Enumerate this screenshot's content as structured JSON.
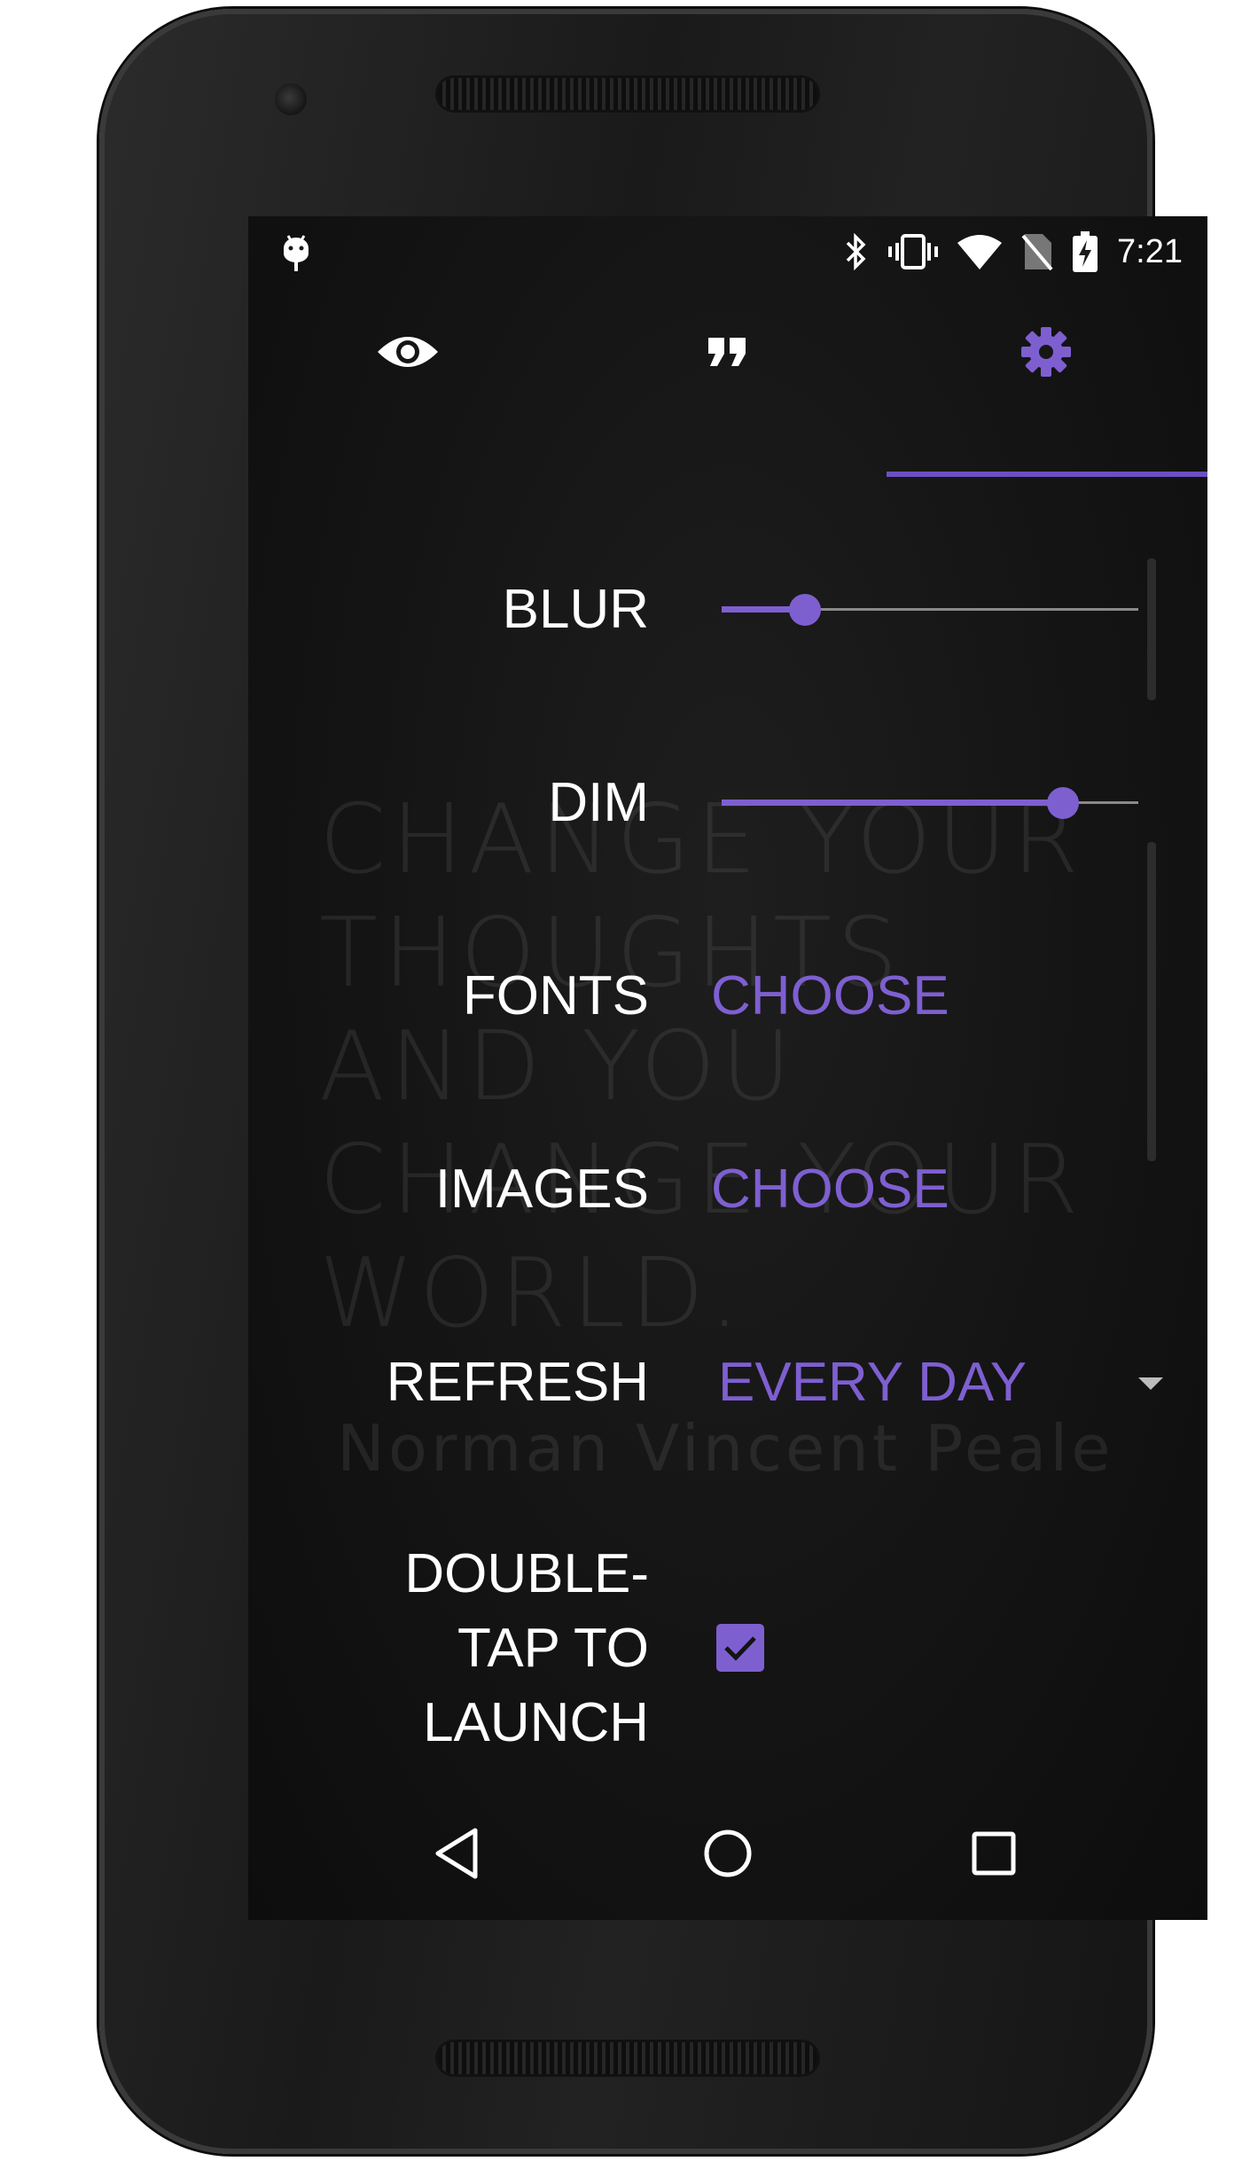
{
  "status_bar": {
    "time": "7:21",
    "icons": [
      "android-debug-icon",
      "bluetooth-icon",
      "vibrate-icon",
      "wifi-icon",
      "no-sim-icon",
      "battery-charging-icon"
    ]
  },
  "tabs": [
    {
      "icon": "eye-icon",
      "selected": false
    },
    {
      "icon": "quote-icon",
      "selected": false
    },
    {
      "icon": "settings-gear-icon",
      "selected": true
    }
  ],
  "settings": {
    "blur": {
      "label": "BLUR",
      "value": 0.2
    },
    "dim": {
      "label": "DIM",
      "value": 0.82
    },
    "fonts": {
      "label": "FONTS",
      "action": "CHOOSE"
    },
    "images": {
      "label": "IMAGES",
      "action": "CHOOSE"
    },
    "refresh": {
      "label": "REFRESH",
      "value": "EVERY DAY"
    },
    "double_tap": {
      "label": "DOUBLE-\nTAP TO\nLAUNCH",
      "checked": true
    }
  },
  "background_quote": {
    "text": "CHANGE YOUR\nTHOUGHTS\nAND YOU\nCHANGE YOUR\nWORLD.",
    "author": "Norman Vincent Peale"
  },
  "nav_bar": [
    "back-icon",
    "home-icon",
    "recents-icon"
  ],
  "colors": {
    "accent": "#7e5fd0",
    "background": "#141414",
    "text": "#ffffff"
  }
}
